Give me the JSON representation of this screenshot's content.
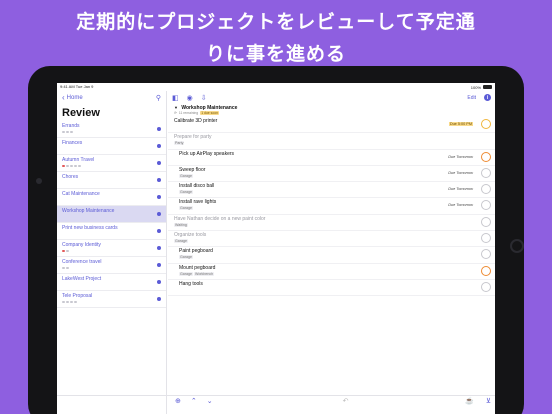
{
  "caption": {
    "line1": "定期的にプロジェクトをレビューして予定通",
    "line2": "りに事を進める"
  },
  "status_bar": {
    "time": "9:41 AM",
    "date": "Tue Jan 9",
    "battery": "100%"
  },
  "sidebar": {
    "back_label": "Home",
    "title": "Review",
    "projects": [
      {
        "name": "Errands",
        "dots": [
          "gray",
          "gray",
          "gray"
        ]
      },
      {
        "name": "Finances",
        "dots": []
      },
      {
        "name": "Autumn Travel",
        "dots": [
          "red",
          "gray",
          "gray",
          "gray",
          "gray"
        ]
      },
      {
        "name": "Chores",
        "dots": []
      },
      {
        "name": "Cat Maintenance",
        "dots": []
      },
      {
        "name": "Workshop Maintenance",
        "dots": []
      },
      {
        "name": "Print new business cards",
        "dots": []
      },
      {
        "name": "Company Identity",
        "dots": [
          "red",
          "gray"
        ]
      },
      {
        "name": "Conference travel",
        "dots": [
          "gray",
          "gray"
        ]
      },
      {
        "name": "LakeWest Project",
        "dots": []
      },
      {
        "name": "Tele Proposal",
        "dots": [
          "gray",
          "gray",
          "gray",
          "gray"
        ]
      }
    ]
  },
  "main": {
    "edit_label": "Edit",
    "project_title": "Workshop Maintenance",
    "project_meta_remaining": "11 remaining",
    "project_meta_due": "1 due soon",
    "tasks": [
      {
        "name": "Calibrate 3D printer",
        "tags": [],
        "due": "Due 5:00 PM",
        "due_style": "orange",
        "circle": "yellow",
        "indent": 0,
        "gray": false
      },
      {
        "name": "Prepare for party",
        "tags": [
          "Party"
        ],
        "due": "",
        "due_style": "",
        "circle": "",
        "indent": 0,
        "gray": true
      },
      {
        "name": "Pick up AirPlay speakers",
        "tags": [],
        "due": "Due Tomorrow",
        "due_style": "",
        "circle": "orange",
        "indent": 1,
        "gray": false
      },
      {
        "name": "Sweep floor",
        "tags": [
          "Garage"
        ],
        "due": "Due Tomorrow",
        "due_style": "",
        "circle": "plain",
        "indent": 1,
        "gray": false
      },
      {
        "name": "Install disco ball",
        "tags": [
          "Garage"
        ],
        "due": "Due Tomorrow",
        "due_style": "",
        "circle": "plain",
        "indent": 1,
        "gray": false
      },
      {
        "name": "Install rave lights",
        "tags": [
          "Garage"
        ],
        "due": "Due Tomorrow",
        "due_style": "",
        "circle": "plain",
        "indent": 1,
        "gray": false
      },
      {
        "name": "Have Nathan decide on a new paint color",
        "tags": [
          "Waiting"
        ],
        "due": "",
        "due_style": "",
        "circle": "plain",
        "indent": 0,
        "gray": true
      },
      {
        "name": "Organize tools",
        "tags": [
          "Garage"
        ],
        "due": "",
        "due_style": "",
        "circle": "plain",
        "indent": 0,
        "gray": true
      },
      {
        "name": "Paint pegboard",
        "tags": [
          "Garage"
        ],
        "due": "",
        "due_style": "",
        "circle": "plain",
        "indent": 1,
        "gray": false
      },
      {
        "name": "Mount pegboard",
        "tags": [
          "Garage",
          "Workbench"
        ],
        "due": "",
        "due_style": "",
        "circle": "orange",
        "indent": 1,
        "gray": false
      },
      {
        "name": "Hang tools",
        "tags": [],
        "due": "",
        "due_style": "",
        "circle": "plain",
        "indent": 1,
        "gray": false
      }
    ]
  }
}
